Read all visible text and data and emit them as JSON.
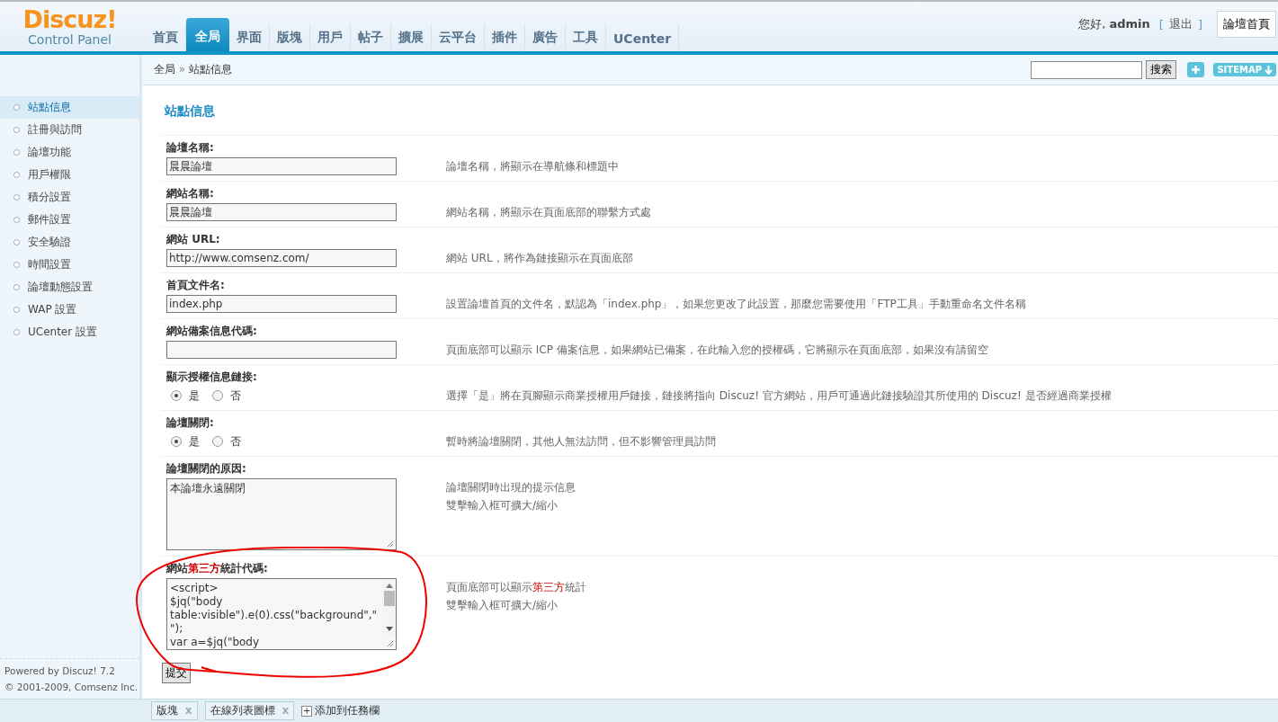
{
  "logo": {
    "name": "Discuz!",
    "subtitle": "Control Panel"
  },
  "nav": [
    {
      "label": "首頁",
      "selected": false
    },
    {
      "label": "全局",
      "selected": true
    },
    {
      "label": "界面",
      "selected": false
    },
    {
      "label": "版塊",
      "selected": false
    },
    {
      "label": "用戶",
      "selected": false
    },
    {
      "label": "帖子",
      "selected": false
    },
    {
      "label": "擴展",
      "selected": false
    },
    {
      "label": "云平台",
      "selected": false
    },
    {
      "label": "插件",
      "selected": false
    },
    {
      "label": "廣告",
      "selected": false
    },
    {
      "label": "工具",
      "selected": false
    },
    {
      "label": "UCenter",
      "selected": false
    }
  ],
  "user": {
    "greeting": "您好,",
    "name": "admin",
    "logout_open": "[",
    "logout": "退出",
    "logout_close": "]",
    "home_button": "論壇首頁"
  },
  "breadcrumb": {
    "parent": "全局",
    "separator": "»",
    "current": "站點信息"
  },
  "search": {
    "button": "搜索",
    "sitemap": "SITEMAP"
  },
  "sidebar": [
    {
      "label": "站點信息",
      "selected": true
    },
    {
      "label": "註冊與訪問",
      "selected": false
    },
    {
      "label": "論壇功能",
      "selected": false
    },
    {
      "label": "用戶權限",
      "selected": false
    },
    {
      "label": "積分設置",
      "selected": false
    },
    {
      "label": "郵件設置",
      "selected": false
    },
    {
      "label": "安全驗證",
      "selected": false
    },
    {
      "label": "時間設置",
      "selected": false
    },
    {
      "label": "論壇動態設置",
      "selected": false
    },
    {
      "label": "WAP 設置",
      "selected": false
    },
    {
      "label": "UCenter 設置",
      "selected": false
    }
  ],
  "powered": {
    "line1": "Powered by Discuz! 7.2",
    "line2": "© 2001-2009, Comsenz Inc."
  },
  "page_title": "站點信息",
  "fields": [
    {
      "kind": "text",
      "label": "論壇名稱:",
      "value": "晨晨論壇",
      "hints": [
        "論壇名稱，將顯示在導航條和標題中"
      ]
    },
    {
      "kind": "text",
      "label": "網站名稱:",
      "value": "晨晨論壇",
      "hints": [
        "網站名稱，將顯示在頁面底部的聯繫方式處"
      ]
    },
    {
      "kind": "text",
      "label": "網站 URL:",
      "value": "http://www.comsenz.com/",
      "hints": [
        "網站 URL，將作為鏈接顯示在頁面底部"
      ]
    },
    {
      "kind": "text",
      "label": "首頁文件名:",
      "value": "index.php",
      "hints": [
        "設置論壇首頁的文件名，默認為「index.php」，如果您更改了此設置，那麼您需要使用「FTP工具」手動重命名文件名稱"
      ]
    },
    {
      "kind": "text",
      "label": "網站備案信息代碼:",
      "hints": [
        "頁面底部可以顯示 ICP 備案信息，如果網站已備案，在此輸入您的授權碼，它將顯示在頁面底部，如果沒有請留空"
      ]
    },
    {
      "kind": "radio",
      "label": "顯示授權信息鏈接:",
      "options": [
        {
          "label": "是",
          "selected": true
        },
        {
          "label": "否",
          "selected": false
        }
      ],
      "hints": [
        "選擇「是」將在頁腳顯示商業授權用戶鏈接，鏈接將指向 Discuz! 官方網站，用戶可通過此鏈接驗證其所使用的 Discuz! 是否經過商業授權"
      ]
    },
    {
      "kind": "radio",
      "label": "論壇關閉:",
      "options": [
        {
          "label": "是",
          "selected": true
        },
        {
          "label": "否",
          "selected": false
        }
      ],
      "hints": [
        "暫時將論壇關閉，其他人無法訪問，但不影響管理員訪問"
      ]
    },
    {
      "kind": "textarea",
      "label": "論壇關閉的原因:",
      "lines": [
        "本論壇永遠關閉"
      ],
      "scrollbar": false,
      "hints": [
        "論壇關閉時出現的提示信息",
        "雙擊輸入框可擴大/縮小"
      ]
    },
    {
      "kind": "textarea",
      "label": "網站**第三方**統計代碼:",
      "lines": [
        "<script>",
        "$jq(\"body",
        "table:visible\").e(0).css(\"background\",\"",
        "\");",
        "var a=$jq(\"body"
      ],
      "scrollbar": true,
      "hints": [
        "頁面底部可以顯示**第三方**統計",
        "雙擊輸入框可擴大/縮小"
      ]
    }
  ],
  "submit": "提交",
  "taskbar": [
    {
      "label": "版塊",
      "close": "x"
    },
    {
      "label": "在線列表圖標",
      "close": "x"
    }
  ],
  "taskbar_add": {
    "icon": "+",
    "label": "添加到任務欄"
  },
  "annotation": true
}
